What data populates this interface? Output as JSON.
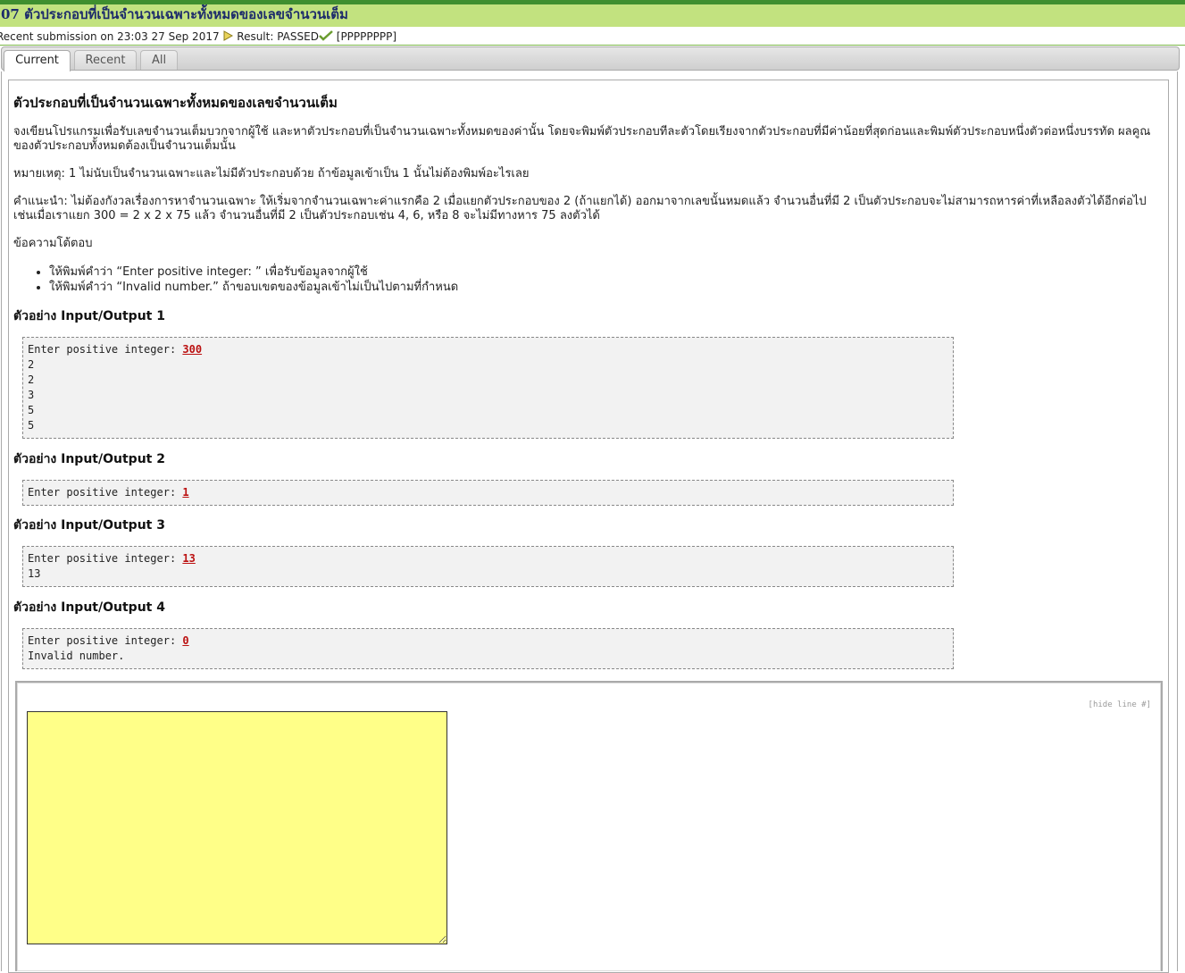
{
  "header": {
    "title": "07 ตัวประกอบที่เป็นจำนวนเฉพาะทั้งหมดของเลขจำนวนเต็ม",
    "submission_text": "Recent submission on 23:03 27 Sep 2017",
    "result_text": "Result: PASSED",
    "result_code": "[PPPPPPPP]",
    "accent_color": "#c2e27f"
  },
  "tabs": [
    {
      "label": "Current",
      "active": true
    },
    {
      "label": "Recent",
      "active": false
    },
    {
      "label": "All",
      "active": false
    }
  ],
  "problem": {
    "title": "ตัวประกอบที่เป็นจำนวนเฉพาะทั้งหมดของเลขจำนวนเต็ม",
    "description": "จงเขียนโปรแกรมเพื่อรับเลขจำนวนเต็มบวกจากผู้ใช้ และหาตัวประกอบที่เป็นจำนวนเฉพาะทั้งหมดของค่านั้น โดยจะพิมพ์ตัวประกอบทีละตัวโดยเรียงจากตัวประกอบที่มีค่าน้อยที่สุดก่อนและพิมพ์ตัวประกอบหนึ่งตัวต่อหนึ่งบรรทัด ผลคูณของตัวประกอบทั้งหมดต้องเป็นจำนวนเต็มนั้น",
    "note": "หมายเหตุ: 1 ไม่นับเป็นจำนวนเฉพาะและไม่มีตัวประกอบด้วย ถ้าข้อมูลเข้าเป็น 1 นั้นไม่ต้องพิมพ์อะไรเลย",
    "hint": "คำแนะนำ: ไม่ต้องกังวลเรื่องการหาจำนวนเฉพาะ ให้เริ่มจากจำนวนเฉพาะค่าแรกคือ 2 เมื่อแยกตัวประกอบของ 2 (ถ้าแยกได้) ออกมาจากเลขนั้นหมดแล้ว จำนวนอื่นที่มี 2 เป็นตัวประกอบจะไม่สามารถหารค่าที่เหลือลงตัวได้อีกต่อไป เช่นเมื่อเราแยก 300 = 2 x 2 x 75 แล้ว จำนวนอื่นที่มี 2 เป็นตัวประกอบเช่น 4, 6, หรือ 8 จะไม่มีทางหาร 75 ลงตัวได้",
    "messages_heading": "ข้อความโต้ตอบ",
    "messages": [
      "ให้พิมพ์คำว่า “Enter positive integer: ” เพื่อรับข้อมูลจากผู้ใช้",
      "ให้พิมพ์คำว่า “Invalid number.” ถ้าขอบเขตของข้อมูลเข้าไม่เป็นไปตามที่กำหนด"
    ]
  },
  "examples": [
    {
      "heading": "ตัวอย่าง Input/Output 1",
      "prompt": "Enter positive integer: ",
      "input": "300",
      "output": "2\n2\n3\n5\n5"
    },
    {
      "heading": "ตัวอย่าง Input/Output 2",
      "prompt": "Enter positive integer: ",
      "input": "1",
      "output": ""
    },
    {
      "heading": "ตัวอย่าง Input/Output 3",
      "prompt": "Enter positive integer: ",
      "input": "13",
      "output": "13"
    },
    {
      "heading": "ตัวอย่าง Input/Output 4",
      "prompt": "Enter positive integer: ",
      "input": "0",
      "output": "Invalid number."
    }
  ],
  "editor": {
    "hide_line_label": "[hide line #]",
    "code": "",
    "background_color": "#ffff88"
  }
}
